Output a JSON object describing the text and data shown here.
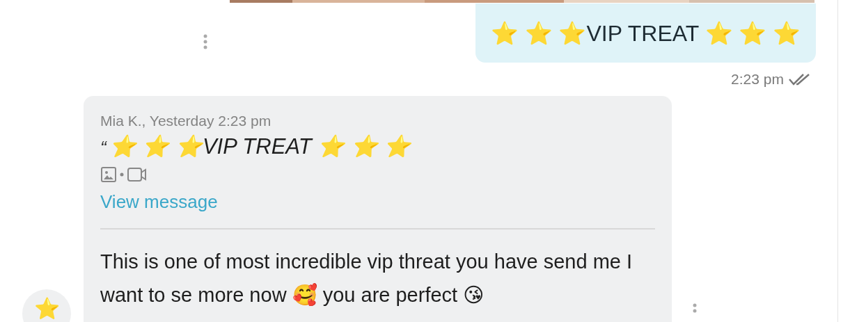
{
  "sent_message": {
    "text": "⭐ ⭐ ⭐VIP TREAT ⭐ ⭐ ⭐",
    "time": "2:23 pm",
    "read": true
  },
  "received_message": {
    "quote": {
      "author": "Mia K., Yesterday 2:23 pm",
      "mark": "“",
      "text": "⭐ ⭐ ⭐VIP TREAT ⭐ ⭐ ⭐",
      "link": "View message"
    },
    "text": "This is one of most incredible vip threat you have send me I want to se more now 🥰 you are perfect 😘",
    "avatar": "⭐"
  }
}
